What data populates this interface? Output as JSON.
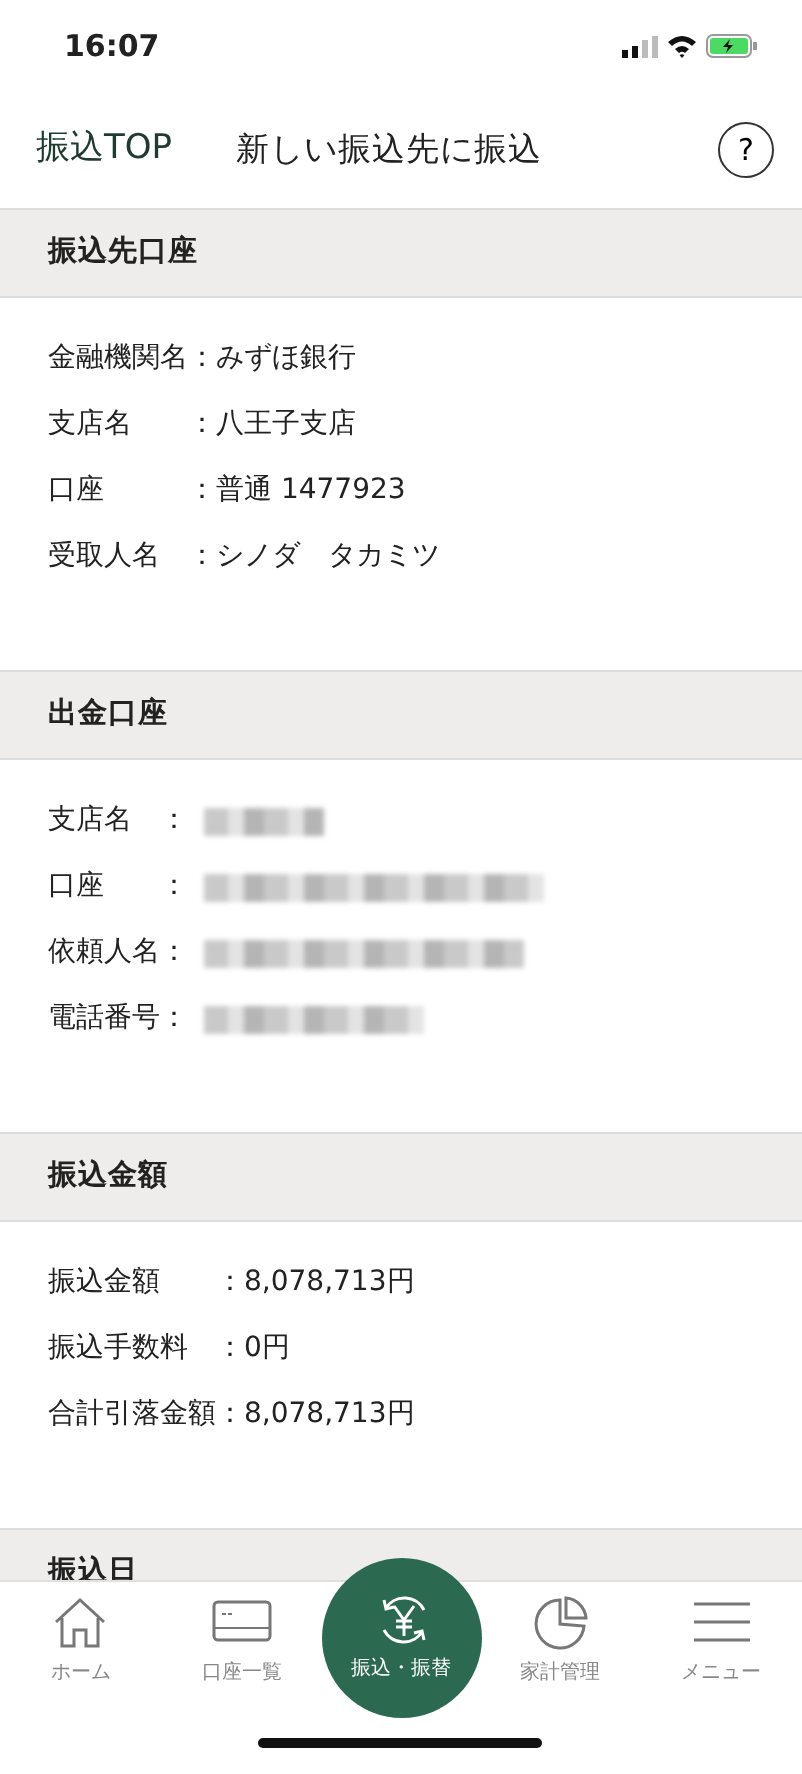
{
  "status_bar": {
    "time": "16:07"
  },
  "header": {
    "back": "振込TOP",
    "title": "新しい振込先に振込",
    "help": "?"
  },
  "sections": [
    {
      "title": "振込先口座",
      "rows": [
        {
          "label": "金融機関名",
          "value": "：みずほ銀行",
          "redacted": false
        },
        {
          "label": "支店名",
          "value": "：八王子支店",
          "redacted": false
        },
        {
          "label": "口座",
          "value": "：普通 1477923",
          "redacted": false
        },
        {
          "label": "受取人名",
          "value": "：シノダ　タカミツ",
          "redacted": false
        }
      ]
    },
    {
      "title": "出金口座",
      "rows": [
        {
          "label": "支店名",
          "value": "：",
          "redacted": true
        },
        {
          "label": "口座",
          "value": "：",
          "redacted": true
        },
        {
          "label": "依頼人名",
          "value": "：",
          "redacted": true
        },
        {
          "label": "電話番号",
          "value": "：",
          "redacted": true
        }
      ]
    },
    {
      "title": "振込金額",
      "rows": [
        {
          "label": "振込金額",
          "value": "：8,078,713円",
          "redacted": false
        },
        {
          "label": "振込手数料",
          "value": "：0円",
          "redacted": false
        },
        {
          "label": "合計引落金額",
          "value": "：8,078,713円",
          "redacted": false
        }
      ]
    },
    {
      "title": "振込日"
    }
  ],
  "tab_bar": [
    {
      "kind": "home",
      "label": "ホーム",
      "selected": false
    },
    {
      "kind": "card",
      "label": "口座一覧",
      "selected": false
    },
    {
      "kind": "transfer",
      "label": "振込・振替",
      "selected": true
    },
    {
      "kind": "pie",
      "label": "家計管理",
      "selected": false
    },
    {
      "kind": "menu",
      "label": "メニュー",
      "selected": false
    }
  ]
}
